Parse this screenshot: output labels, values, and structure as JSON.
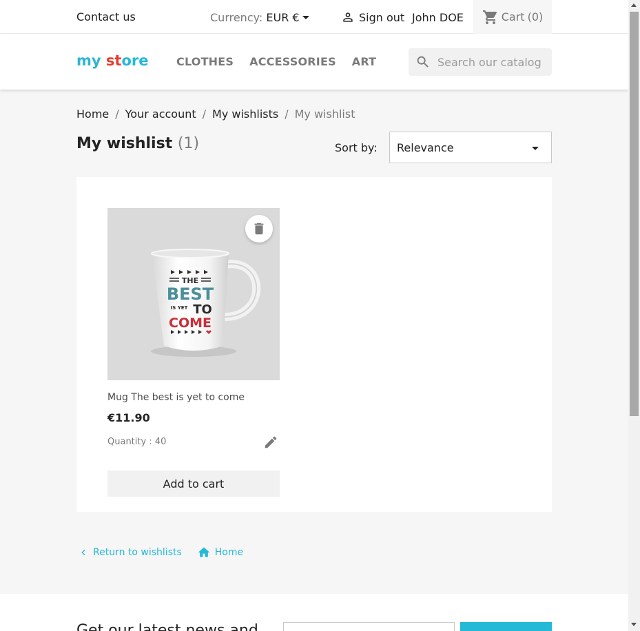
{
  "topbar": {
    "contact": "Contact us",
    "currency_label": "Currency:",
    "currency_value": "EUR €",
    "signout": "Sign out",
    "user": "John DOE",
    "cart": "Cart",
    "cart_count": "(0)"
  },
  "header": {
    "logo_part1": "my",
    "logo_part2": " st",
    "logo_part3": "ore",
    "nav": [
      "CLOTHES",
      "ACCESSORIES",
      "ART"
    ],
    "search_placeholder": "Search our catalog"
  },
  "breadcrumb": {
    "items": [
      "Home",
      "Your account",
      "My wishlists",
      "My wishlist"
    ],
    "separator": "/"
  },
  "page": {
    "title": "My wishlist",
    "count": "(1)",
    "sort_label": "Sort by:",
    "sort_value": "Relevance"
  },
  "products": [
    {
      "name": "Mug The best is yet to come",
      "price": "€11.90",
      "quantity": "Quantity : 40",
      "add_to_cart": "Add to cart",
      "mug_text": [
        "THE",
        "BEST",
        "IS YET",
        "TO",
        "COME"
      ]
    }
  ],
  "footer_links": {
    "return": "Return to wishlists",
    "home": "Home"
  },
  "newsletter": {
    "title": "Get our latest news and"
  },
  "colors": {
    "accent": "#24b9d7",
    "logo_red": "#e63b2e",
    "text": "#232323",
    "muted": "#7a7a7a"
  },
  "icons": [
    "person-icon",
    "cart-icon",
    "search-icon",
    "trash-icon",
    "pencil-icon",
    "chevron-left-icon",
    "home-icon"
  ]
}
